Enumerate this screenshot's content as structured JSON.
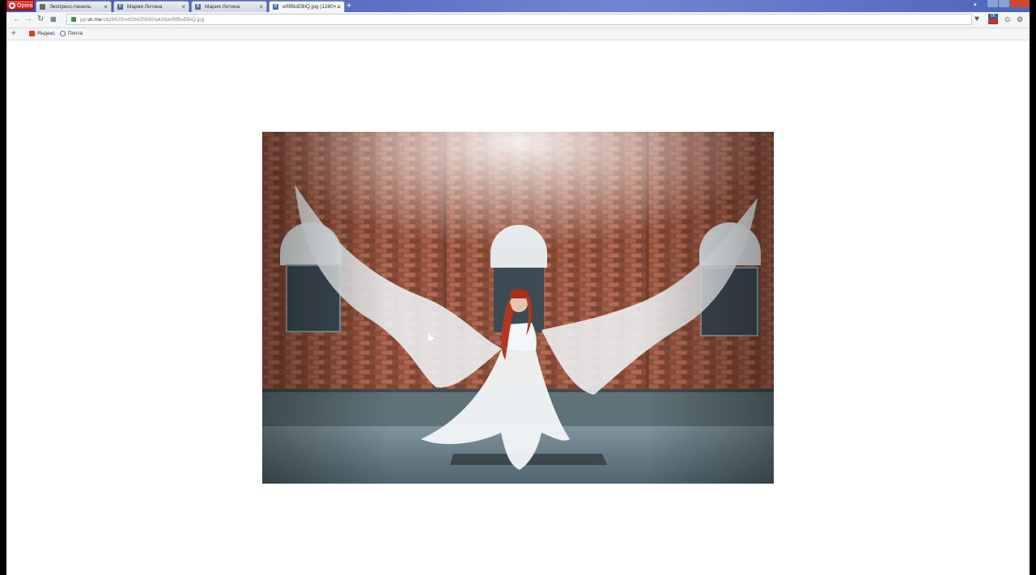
{
  "browser": {
    "logo_label": "Opera",
    "tabs": [
      {
        "title": "Экспресс-панель",
        "favicon": "grid-icon",
        "active": false
      },
      {
        "title": "Мария Литина",
        "favicon": "vk-icon",
        "active": false
      },
      {
        "title": "Мария Литина",
        "favicon": "vk-icon",
        "active": false
      },
      {
        "title": "eIfIfBoEBiQ.jpg (1280×...",
        "favicon": "vk-icon",
        "active": true
      }
    ],
    "new_tab_label": "+",
    "address": {
      "prefix": "pp.",
      "domain": "vk.me",
      "path": "/c629425/v629425500/a426/eIfIfBoEBiQ.jpg"
    },
    "bookmarks": [
      {
        "label": "Яндекс",
        "icon": "yandex-icon"
      },
      {
        "label": "Почта",
        "icon": "mail-icon"
      }
    ],
    "accent_color": "#4a5fb8",
    "close_color": "#d0482f"
  },
  "content": {
    "image": "photo of a red-haired woman in a white dress with large flowing white fabric wings in front of a brick building",
    "background_color": "#ffffff"
  }
}
